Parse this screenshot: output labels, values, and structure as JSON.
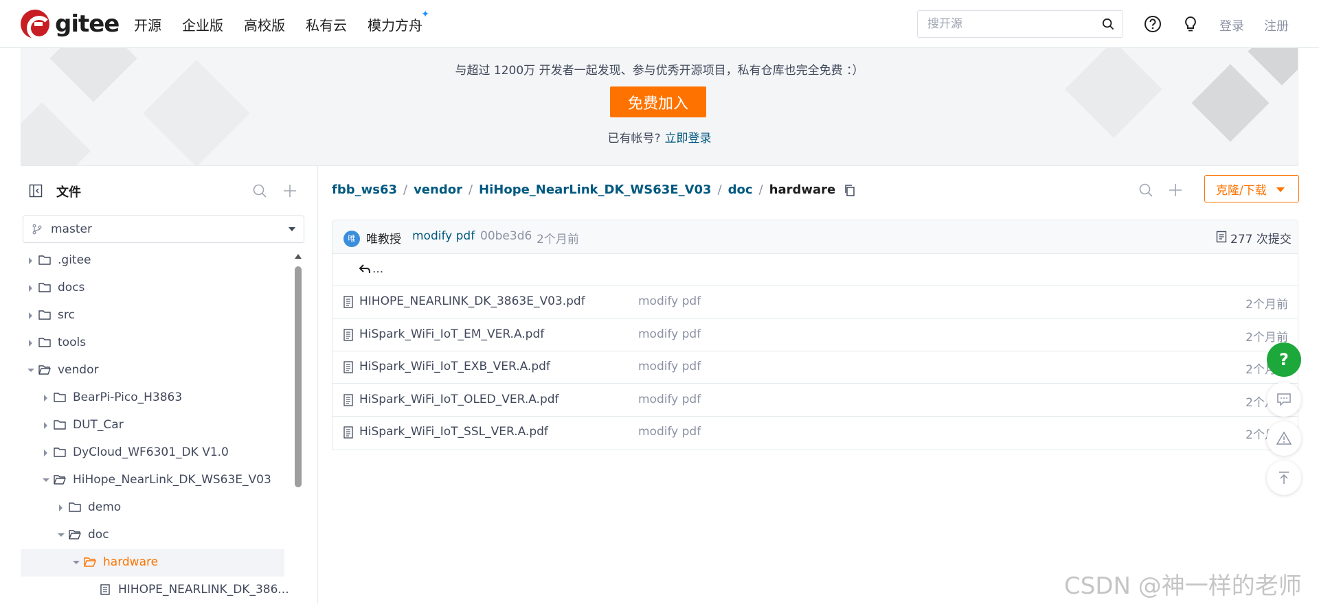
{
  "header": {
    "logo_text": "gitee",
    "nav": [
      "开源",
      "企业版",
      "高校版",
      "私有云",
      "模力方舟"
    ],
    "nav_star": "✦",
    "search_placeholder": "搜开源",
    "login": "登录",
    "register": "注册"
  },
  "banner": {
    "text": "与超过 1200万 开发者一起发现、参与优秀开源项目，私有仓库也完全免费 ：）",
    "join_button": "免费加入",
    "has_account": "已有帐号?",
    "login_now": "立即登录"
  },
  "sidebar": {
    "title": "文件",
    "branch": "master",
    "tree": [
      {
        "label": ".gitee",
        "depth": 0,
        "state": "closed",
        "type": "folder"
      },
      {
        "label": "docs",
        "depth": 0,
        "state": "closed",
        "type": "folder"
      },
      {
        "label": "src",
        "depth": 0,
        "state": "closed",
        "type": "folder"
      },
      {
        "label": "tools",
        "depth": 0,
        "state": "closed",
        "type": "folder"
      },
      {
        "label": "vendor",
        "depth": 0,
        "state": "open",
        "type": "folder"
      },
      {
        "label": "BearPi-Pico_H3863",
        "depth": 1,
        "state": "closed",
        "type": "folder"
      },
      {
        "label": "DUT_Car",
        "depth": 1,
        "state": "closed",
        "type": "folder"
      },
      {
        "label": "DyCloud_WF6301_DK V1.0",
        "depth": 1,
        "state": "closed",
        "type": "folder"
      },
      {
        "label": "HiHope_NearLink_DK_WS63E_V03",
        "depth": 1,
        "state": "open",
        "type": "folder"
      },
      {
        "label": "demo",
        "depth": 2,
        "state": "closed",
        "type": "folder"
      },
      {
        "label": "doc",
        "depth": 2,
        "state": "open",
        "type": "folder"
      },
      {
        "label": "hardware",
        "depth": 3,
        "state": "open",
        "type": "folder",
        "active": true
      },
      {
        "label": "HIHOPE_NEARLINK_DK_386...",
        "depth": 4,
        "state": "none",
        "type": "file"
      }
    ]
  },
  "breadcrumb": {
    "items": [
      "fbb_ws63",
      "vendor",
      "HiHope_NearLink_DK_WS63E_V03",
      "doc"
    ],
    "current": "hardware",
    "separator": "/"
  },
  "actions": {
    "clone_label": "克隆/下载"
  },
  "commit": {
    "avatar_char": "唯",
    "author": "唯教授",
    "message": "modify pdf",
    "sha": "00be3d6",
    "time": "2个月前",
    "count": "277 次提交"
  },
  "files": {
    "parent": "...",
    "rows": [
      {
        "name": "HIHOPE_NEARLINK_DK_3863E_V03.pdf",
        "message": "modify pdf",
        "time": "2个月前"
      },
      {
        "name": "HiSpark_WiFi_IoT_EM_VER.A.pdf",
        "message": "modify pdf",
        "time": "2个月前"
      },
      {
        "name": "HiSpark_WiFi_IoT_EXB_VER.A.pdf",
        "message": "modify pdf",
        "time": "2个月前"
      },
      {
        "name": "HiSpark_WiFi_IoT_OLED_VER.A.pdf",
        "message": "modify pdf",
        "time": "2个月前"
      },
      {
        "name": "HiSpark_WiFi_IoT_SSL_VER.A.pdf",
        "message": "modify pdf",
        "time": "2个月前"
      }
    ]
  },
  "floating": {
    "help": "?"
  },
  "watermark": "CSDN @神一样的老师",
  "colors": {
    "brand": "#c71d23",
    "accent": "#fe7300",
    "link": "#005980",
    "help_green": "#1ca83a"
  }
}
